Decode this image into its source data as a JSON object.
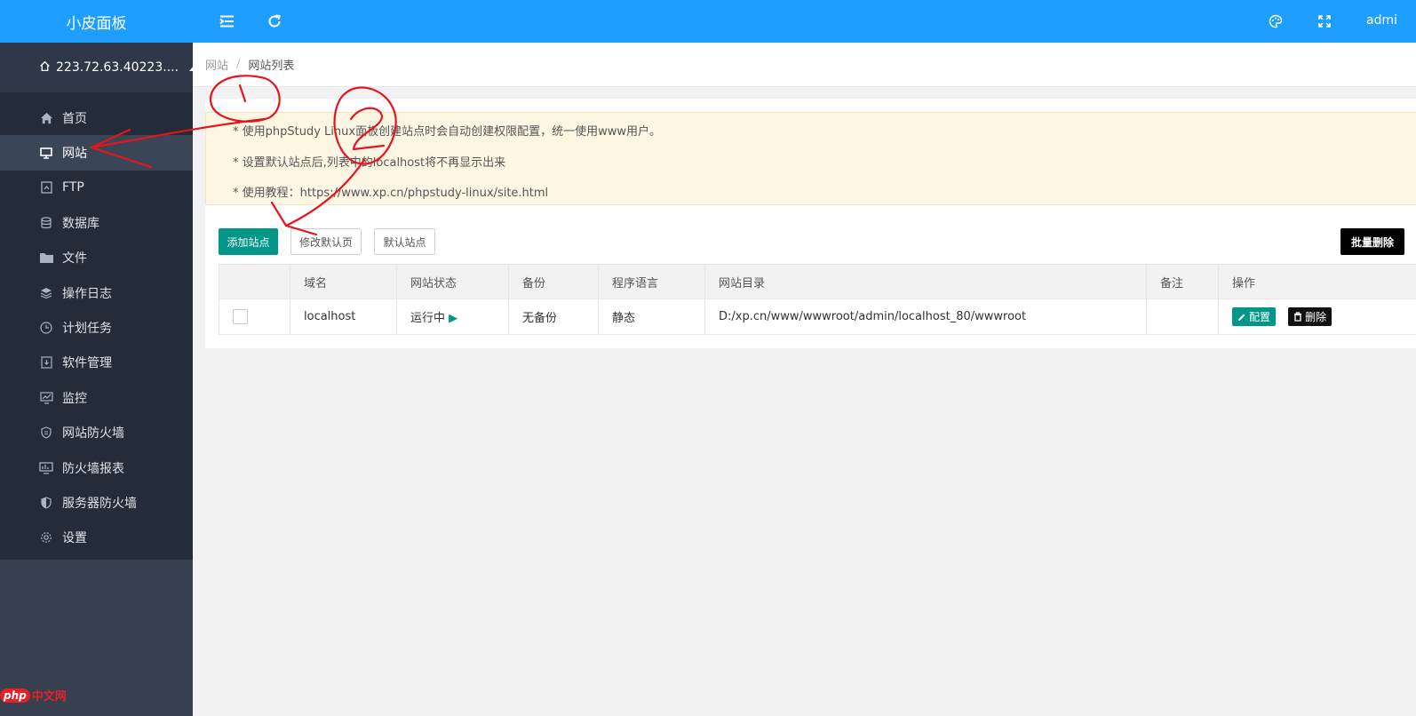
{
  "app": {
    "title": "小皮面板",
    "server": "223.72.63.40223...."
  },
  "topbar": {
    "user": "admi"
  },
  "menu": [
    {
      "label": "首页",
      "icon": "home-icon"
    },
    {
      "label": "网站",
      "icon": "monitor-icon"
    },
    {
      "label": "FTP",
      "icon": "ftp-icon"
    },
    {
      "label": "数据库",
      "icon": "database-icon"
    },
    {
      "label": "文件",
      "icon": "folder-icon"
    },
    {
      "label": "操作日志",
      "icon": "layers-icon"
    },
    {
      "label": "计划任务",
      "icon": "clock-icon"
    },
    {
      "label": "软件管理",
      "icon": "download-icon"
    },
    {
      "label": "监控",
      "icon": "chart-icon"
    },
    {
      "label": "网站防火墙",
      "icon": "shield-icon"
    },
    {
      "label": "防火墙报表",
      "icon": "report-icon"
    },
    {
      "label": "服务器防火墙",
      "icon": "shield-half-icon"
    },
    {
      "label": "设置",
      "icon": "gear-icon"
    }
  ],
  "breadcrumb": {
    "parent": "网站",
    "current": "网站列表"
  },
  "notice": [
    "* 使用phpStudy Linux面板创建站点时会自动创建权限配置，统一使用www用户。",
    "* 设置默认站点后,列表中的localhost将不再显示出来",
    "* 使用教程：https://www.xp.cn/phpstudy-linux/site.html"
  ],
  "toolbar": {
    "add": "添加站点",
    "edit_default": "修改默认页",
    "default_site": "默认站点",
    "batch_delete": "批量删除"
  },
  "table": {
    "headers": [
      "域名",
      "网站状态",
      "备份",
      "程序语言",
      "网站目录",
      "备注",
      "操作"
    ],
    "rows": [
      {
        "domain": "localhost",
        "status": "运行中",
        "status_icon": "▶",
        "backup": "无备份",
        "lang": "静态",
        "dir": "D:/xp.cn/www/wwwroot/admin/localhost_80/wwwroot",
        "note": "",
        "config": "配置",
        "delete": "删除"
      }
    ]
  },
  "watermark": {
    "brand": "php",
    "text": "中文网"
  },
  "colors": {
    "topbar": "#1e9fff",
    "sidebar": "#232c38",
    "accent": "#009688",
    "annotation": "#e6141e"
  }
}
